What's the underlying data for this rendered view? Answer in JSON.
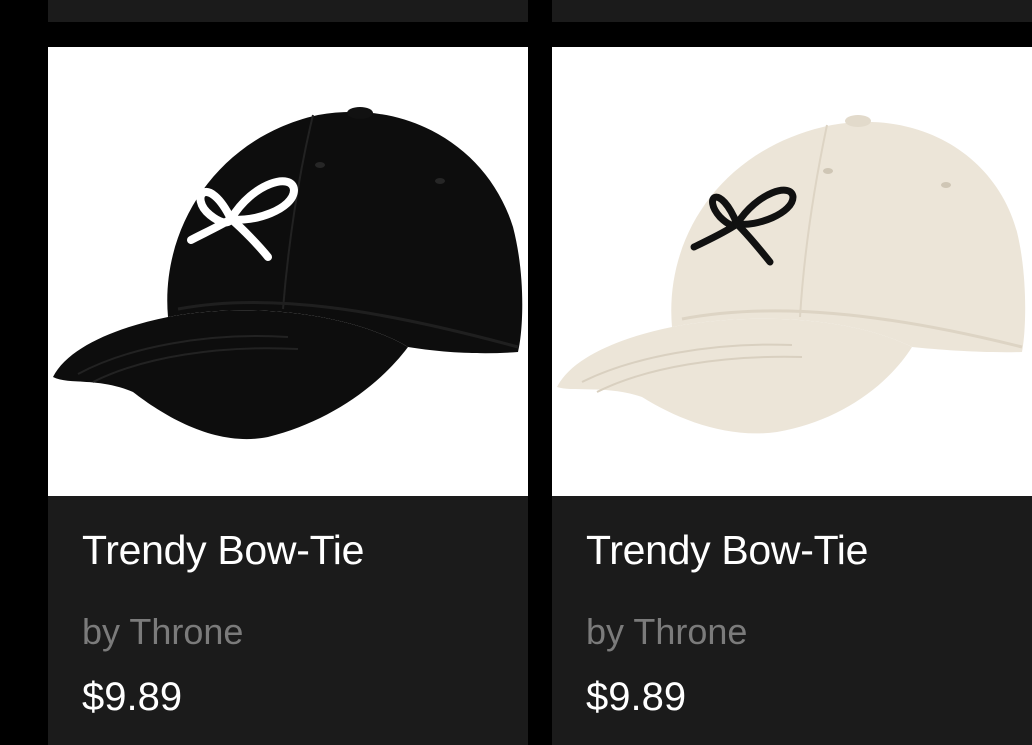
{
  "products": [
    {
      "title": "Trendy Bow-Tie",
      "brand": "by Throne",
      "price": "$9.89",
      "image": "black-baseball-cap-with-white-bow",
      "colors": {
        "cap": "#0d0d0d",
        "bow": "#ffffff"
      }
    },
    {
      "title": "Trendy Bow-Tie",
      "brand": "by Throne",
      "price": "$9.89",
      "image": "beige-baseball-cap-with-black-bow",
      "colors": {
        "cap": "#ece5d8",
        "bow": "#111111"
      }
    }
  ],
  "colors": {
    "background": "#000000",
    "card": "#1b1b1b",
    "title": "#ffffff",
    "brand": "#7b7b7b",
    "price": "#ffffff"
  }
}
